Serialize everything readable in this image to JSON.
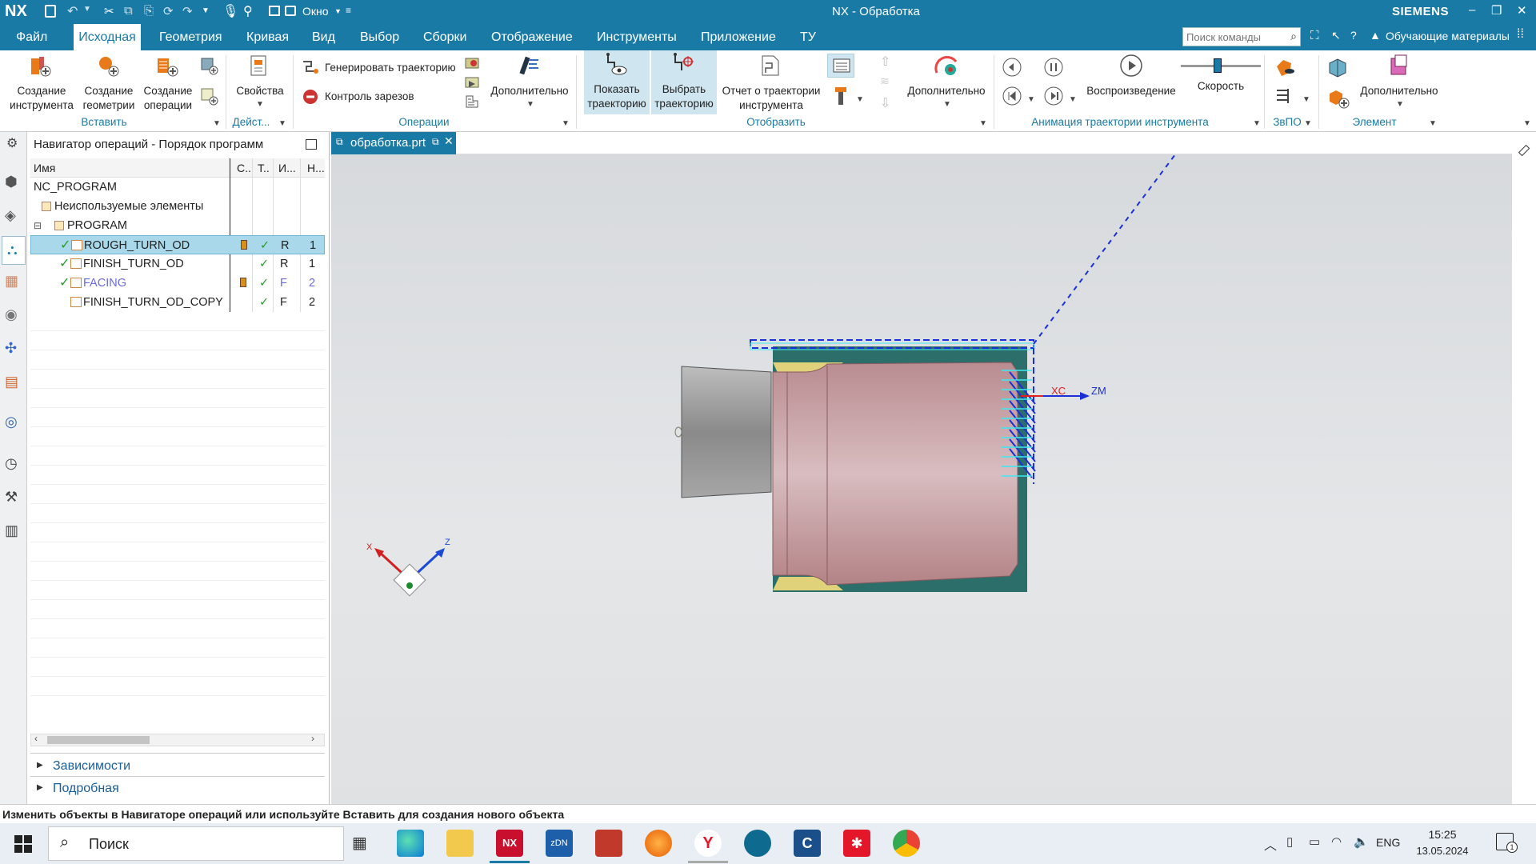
{
  "titlebar": {
    "logo": "NX",
    "window_menu": "Окно",
    "title": "NX - Обработка",
    "brand": "SIEMENS",
    "min": "–",
    "restore": "❐",
    "close": "✕"
  },
  "menubar": {
    "items": [
      "Файл",
      "Исходная",
      "Геометрия",
      "Кривая",
      "Вид",
      "Выбор",
      "Сборки",
      "Отображение",
      "Инструменты",
      "Приложение",
      "ТУ"
    ],
    "active_index": 1,
    "search_placeholder": "Поиск команды",
    "learning": "Обучающие материалы"
  },
  "ribbon": {
    "create_tool": [
      "Создание",
      "инструмента"
    ],
    "create_geometry": [
      "Создание",
      "геометрии"
    ],
    "create_operation": [
      "Создание",
      "операции"
    ],
    "group_insert": "Вставить",
    "properties": "Свойства",
    "group_actions": "Дейст...",
    "generate_path": "Генерировать траекторию",
    "gouge_check": "Контроль зарезов",
    "more": "Дополнительно",
    "group_operations": "Операции",
    "show_path": [
      "Показать",
      "траекторию"
    ],
    "select_path": [
      "Выбрать",
      "траекторию"
    ],
    "path_report": [
      "Отчет о траектории",
      "инструмента"
    ],
    "more2": "Дополнительно",
    "group_display": "Отобразить",
    "playback": "Воспроизведение",
    "speed": "Скорость",
    "speed_level": 0.45,
    "group_animation": "Анимация траектории инструмента",
    "group_ipw": "ЗвПО",
    "more3": "Дополнительно",
    "group_element": "Элемент"
  },
  "navigator": {
    "title": "Навигатор операций - Порядок программ",
    "columns": [
      "Имя",
      "С..",
      "Т..",
      "И...",
      "Н..."
    ],
    "rows": [
      {
        "name": "NC_PROGRAM",
        "c": "",
        "t": "",
        "i": "",
        "n": ""
      },
      {
        "name": "Неиспользуемые элементы",
        "c": "",
        "t": "",
        "i": "",
        "n": ""
      },
      {
        "name": "PROGRAM",
        "c": "",
        "t": "",
        "i": "",
        "n": ""
      },
      {
        "name": "ROUGH_TURN_OD",
        "c": "",
        "t": "✓",
        "i": "R",
        "n": "1"
      },
      {
        "name": "FINISH_TURN_OD",
        "c": "",
        "t": "✓",
        "i": "R",
        "n": "1"
      },
      {
        "name": "FACING",
        "c": "",
        "t": "✓",
        "i": "F",
        "n": "2"
      },
      {
        "name": "FINISH_TURN_OD_COPY",
        "c": "",
        "t": "✓",
        "i": "F",
        "n": "2"
      }
    ],
    "dependencies": "Зависимости",
    "details": "Подробная"
  },
  "tab": {
    "label": "обработка.prt"
  },
  "viewport": {
    "axis_xc": "XC",
    "axis_zm": "ZM",
    "triad_x": "X",
    "triad_z": "Z"
  },
  "status": "Изменить объекты в Навигаторе операций или используйте Вставить для создания нового объекта",
  "taskbar": {
    "search": "Поиск",
    "lang": "ENG",
    "time": "15:25",
    "date": "13.05.2024",
    "notif": "1"
  },
  "colors": {
    "accent": "#1a7aa6",
    "selected_row": "#a8d8ea",
    "toolpath_blue": "#1a2fd6",
    "toolpath_cyan": "#3ee8f0",
    "part": "#c9a2a6",
    "stock": "#2c6e6a"
  }
}
